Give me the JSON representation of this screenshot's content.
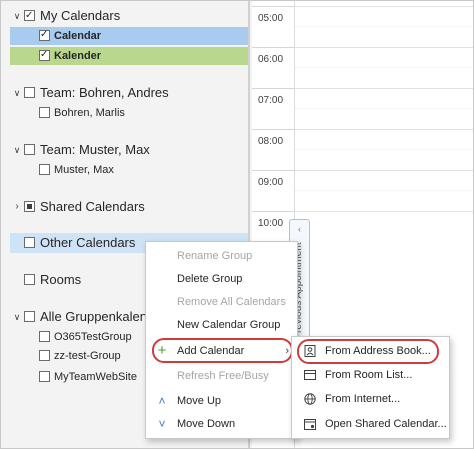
{
  "folder_pane": {
    "my_calendars": {
      "label": "My Calendars",
      "items": [
        {
          "label": "Calendar"
        },
        {
          "label": "Kalender"
        }
      ]
    },
    "team_bohren": {
      "label": "Team: Bohren, Andres",
      "items": [
        {
          "label": "Bohren, Marlis"
        }
      ]
    },
    "team_muster": {
      "label": "Team: Muster, Max",
      "items": [
        {
          "label": "Muster, Max"
        }
      ]
    },
    "shared_calendars": {
      "label": "Shared Calendars"
    },
    "other_calendars": {
      "label": "Other Calendars"
    },
    "rooms": {
      "label": "Rooms"
    },
    "alle_gruppen": {
      "label": "Alle Gruppenkalender",
      "items": [
        {
          "label": "O365TestGroup"
        },
        {
          "label": "zz-test-Group"
        },
        {
          "label": "MyTeamWebSite"
        }
      ]
    }
  },
  "time_labels": [
    "05:00",
    "06:00",
    "07:00",
    "08:00",
    "09:00",
    "10:00"
  ],
  "previous_appointment_label": "Previous Appointment",
  "context_menu": {
    "rename_group": "Rename Group",
    "delete_group": "Delete Group",
    "remove_all_calendars": "Remove All Calendars",
    "new_calendar_group": "New Calendar Group",
    "add_calendar": "Add Calendar",
    "refresh_free_busy": "Refresh Free/Busy",
    "move_up": "Move Up",
    "move_down": "Move Down"
  },
  "add_calendar_submenu": {
    "from_address_book": "From Address Book...",
    "from_room_list": "From Room List...",
    "from_internet": "From Internet...",
    "open_shared_calendar": "Open Shared Calendar..."
  },
  "colors": {
    "calendar_blue": "#a8cbf0",
    "kalender_green": "#b9d88d",
    "highlight_red": "#d23b3b",
    "accent": "#3a7bbf"
  }
}
